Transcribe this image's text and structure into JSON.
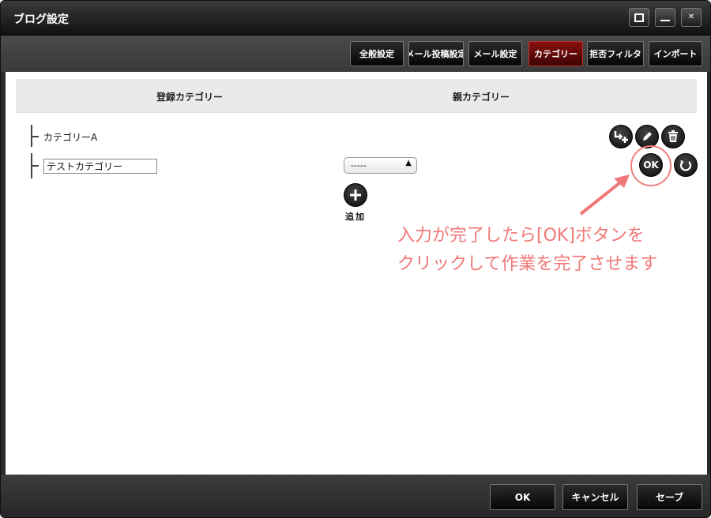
{
  "window": {
    "title": "ブログ設定"
  },
  "tabs": [
    {
      "label": "全般設定",
      "active": false
    },
    {
      "label": "メール投稿設定",
      "active": false
    },
    {
      "label": "メール設定",
      "active": false
    },
    {
      "label": "カテゴリー",
      "active": true
    },
    {
      "label": "拒否フィルタ",
      "active": false
    },
    {
      "label": "インポート",
      "active": false
    }
  ],
  "table": {
    "col_registered": "登録カテゴリー",
    "col_parent": "親カテゴリー"
  },
  "categories": [
    {
      "name": "カテゴリーA"
    }
  ],
  "edit_row": {
    "input_value": "テストカテゴリー",
    "parent_select": "-----",
    "ok_label": "OK"
  },
  "add": {
    "label": "追加"
  },
  "annotation": {
    "line1": "入力が完了したら[OK]ボタンを",
    "line2": "クリックして作業を完了させます",
    "color": "#f07878"
  },
  "footer": {
    "ok": "OK",
    "cancel": "キャンセル",
    "save": "セーブ"
  },
  "colors": {
    "active_tab": "#8a1010",
    "titlebar": "#1c1c1c"
  }
}
